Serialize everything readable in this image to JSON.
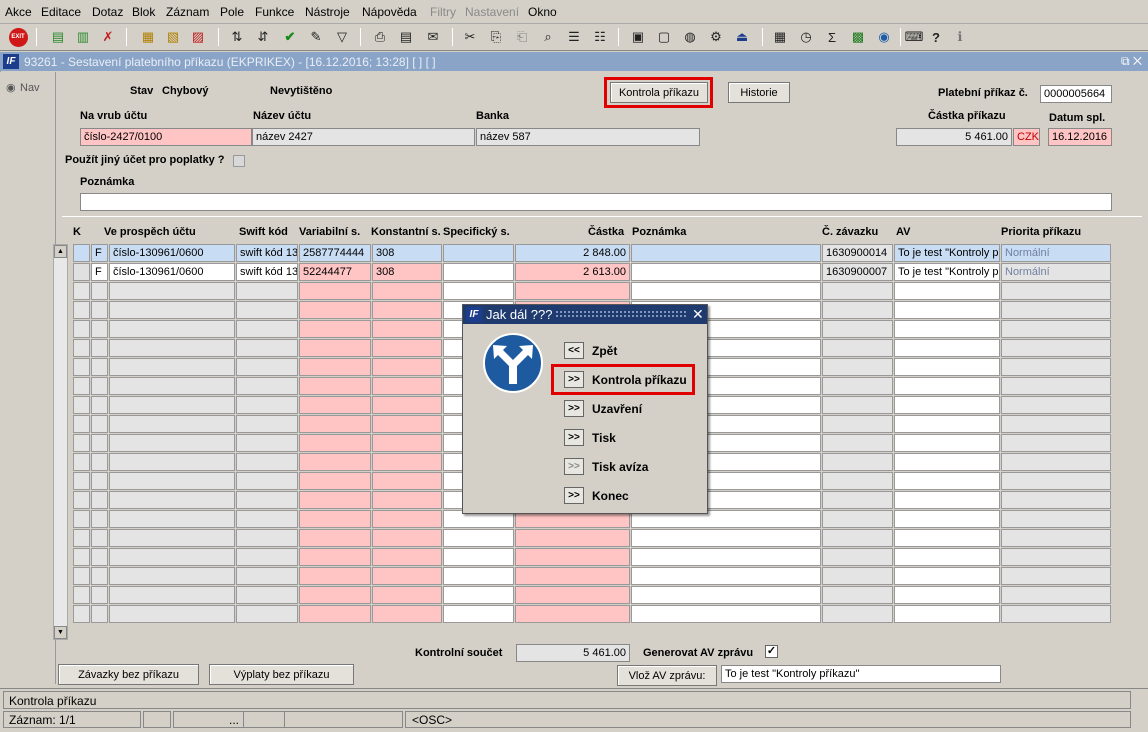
{
  "menu": [
    "Akce",
    "Editace",
    "Dotaz",
    "Blok",
    "Záznam",
    "Pole",
    "Funkce",
    "Nástroje",
    "Nápověda",
    "Filtry",
    "Nastavení",
    "Okno"
  ],
  "toolbar": {
    "exit_label": "EXIT"
  },
  "window": {
    "title": "93261 - Sestavení platebního příkazu (EKPRIKEX) - [16.12.2016; 13:28]  [ ]  [ ]",
    "logo": "IF",
    "controls": "⧉ ✕"
  },
  "nav": {
    "label": "Nav"
  },
  "header": {
    "stav_label": "Stav",
    "stav_value": "Chybový",
    "print_status": "Nevytištěno",
    "kontrola_btn": "Kontrola příkazu",
    "historie_btn": "Historie",
    "prikaz_label": "Platební příkaz č.",
    "prikaz_value": "0000005664",
    "na_vrub_label": "Na vrub účtu",
    "na_vrub_value": "číslo-2427/0100",
    "nazev_label": "Název účtu",
    "nazev_value": "název 2427",
    "banka_label": "Banka",
    "banka_value": "název 587",
    "castka_label": "Částka příkazu",
    "castka_value": "5 461.00",
    "mena": "CZK",
    "datum_label": "Datum spl.",
    "datum_value": "16.12.2016",
    "jiny_ucet_label": "Použít jiný účet pro poplatky ?",
    "poznamka_label": "Poznámka",
    "poznamka_value": ""
  },
  "table": {
    "headers": [
      "K",
      "Ve prospěch účtu",
      "Swift kód",
      "Variabilní s.",
      "Konstantní s.",
      "Specifický s.",
      "Částka",
      "Poznámka",
      "Č. závazku",
      "AV",
      "Priorita příkazu"
    ],
    "rows": [
      {
        "k": "",
        "f": "F",
        "ucet": "číslo-130961/0600",
        "swift": "swift kód 13",
        "vs": "2587774444",
        "ks": "308",
        "ss": "",
        "castka": "2 848.00",
        "pozn": "",
        "zavazek": "1630900014",
        "av": "To je test \"Kontroly př",
        "priorita": "Normální"
      },
      {
        "k": "",
        "f": "F",
        "ucet": "číslo-130961/0600",
        "swift": "swift kód 13",
        "vs": "52244477",
        "ks": "308",
        "ss": "",
        "castka": "2 613.00",
        "pozn": "",
        "zavazek": "1630900007",
        "av": "To je test \"Kontroly př",
        "priorita": "Normální"
      }
    ]
  },
  "footer": {
    "kontrolni_label": "Kontrolní součet",
    "kontrolni_value": "5 461.00",
    "generovat_label": "Generovat AV zprávu",
    "generovat_checked": "✓",
    "zavazky_btn": "Závazky bez příkazu",
    "vyplaty_btn": "Výplaty bez příkazu",
    "vloz_btn": "Vlož AV zprávu:",
    "av_zprava": "To je test \"Kontroly příkazu\""
  },
  "dialog": {
    "title": "Jak dál ???",
    "close": "✕",
    "items": [
      {
        "btn": "<<",
        "label": "Zpět"
      },
      {
        "btn": ">>",
        "label": "Kontrola příkazu"
      },
      {
        "btn": ">>",
        "label": "Uzavření"
      },
      {
        "btn": ">>",
        "label": "Tisk"
      },
      {
        "btn": ">>",
        "label": "Tisk avíza"
      },
      {
        "btn": ">>",
        "label": "Konec"
      }
    ]
  },
  "status": {
    "message": "Kontrola příkazu",
    "record": "Záznam: 1/1",
    "dots": "...",
    "osc": "<OSC>"
  },
  "colors": {
    "pink": "#ffc4c4",
    "blue": "#c8dcf4",
    "red_highlight": "#e00000",
    "title_bar": "#1e3a6e"
  }
}
